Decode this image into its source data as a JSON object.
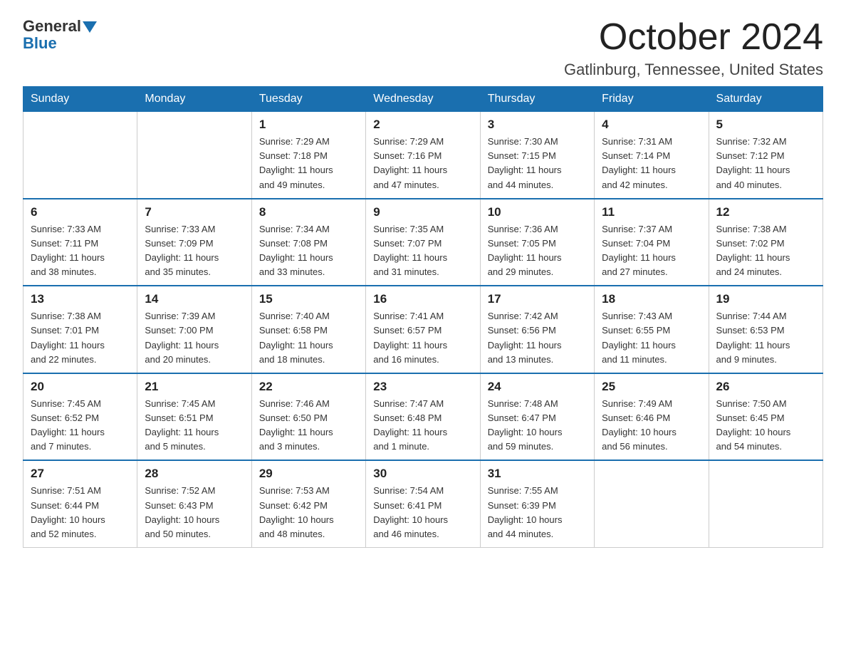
{
  "logo": {
    "general": "General",
    "blue": "Blue"
  },
  "title": "October 2024",
  "location": "Gatlinburg, Tennessee, United States",
  "weekdays": [
    "Sunday",
    "Monday",
    "Tuesday",
    "Wednesday",
    "Thursday",
    "Friday",
    "Saturday"
  ],
  "weeks": [
    [
      {
        "day": "",
        "info": ""
      },
      {
        "day": "",
        "info": ""
      },
      {
        "day": "1",
        "info": "Sunrise: 7:29 AM\nSunset: 7:18 PM\nDaylight: 11 hours\nand 49 minutes."
      },
      {
        "day": "2",
        "info": "Sunrise: 7:29 AM\nSunset: 7:16 PM\nDaylight: 11 hours\nand 47 minutes."
      },
      {
        "day": "3",
        "info": "Sunrise: 7:30 AM\nSunset: 7:15 PM\nDaylight: 11 hours\nand 44 minutes."
      },
      {
        "day": "4",
        "info": "Sunrise: 7:31 AM\nSunset: 7:14 PM\nDaylight: 11 hours\nand 42 minutes."
      },
      {
        "day": "5",
        "info": "Sunrise: 7:32 AM\nSunset: 7:12 PM\nDaylight: 11 hours\nand 40 minutes."
      }
    ],
    [
      {
        "day": "6",
        "info": "Sunrise: 7:33 AM\nSunset: 7:11 PM\nDaylight: 11 hours\nand 38 minutes."
      },
      {
        "day": "7",
        "info": "Sunrise: 7:33 AM\nSunset: 7:09 PM\nDaylight: 11 hours\nand 35 minutes."
      },
      {
        "day": "8",
        "info": "Sunrise: 7:34 AM\nSunset: 7:08 PM\nDaylight: 11 hours\nand 33 minutes."
      },
      {
        "day": "9",
        "info": "Sunrise: 7:35 AM\nSunset: 7:07 PM\nDaylight: 11 hours\nand 31 minutes."
      },
      {
        "day": "10",
        "info": "Sunrise: 7:36 AM\nSunset: 7:05 PM\nDaylight: 11 hours\nand 29 minutes."
      },
      {
        "day": "11",
        "info": "Sunrise: 7:37 AM\nSunset: 7:04 PM\nDaylight: 11 hours\nand 27 minutes."
      },
      {
        "day": "12",
        "info": "Sunrise: 7:38 AM\nSunset: 7:02 PM\nDaylight: 11 hours\nand 24 minutes."
      }
    ],
    [
      {
        "day": "13",
        "info": "Sunrise: 7:38 AM\nSunset: 7:01 PM\nDaylight: 11 hours\nand 22 minutes."
      },
      {
        "day": "14",
        "info": "Sunrise: 7:39 AM\nSunset: 7:00 PM\nDaylight: 11 hours\nand 20 minutes."
      },
      {
        "day": "15",
        "info": "Sunrise: 7:40 AM\nSunset: 6:58 PM\nDaylight: 11 hours\nand 18 minutes."
      },
      {
        "day": "16",
        "info": "Sunrise: 7:41 AM\nSunset: 6:57 PM\nDaylight: 11 hours\nand 16 minutes."
      },
      {
        "day": "17",
        "info": "Sunrise: 7:42 AM\nSunset: 6:56 PM\nDaylight: 11 hours\nand 13 minutes."
      },
      {
        "day": "18",
        "info": "Sunrise: 7:43 AM\nSunset: 6:55 PM\nDaylight: 11 hours\nand 11 minutes."
      },
      {
        "day": "19",
        "info": "Sunrise: 7:44 AM\nSunset: 6:53 PM\nDaylight: 11 hours\nand 9 minutes."
      }
    ],
    [
      {
        "day": "20",
        "info": "Sunrise: 7:45 AM\nSunset: 6:52 PM\nDaylight: 11 hours\nand 7 minutes."
      },
      {
        "day": "21",
        "info": "Sunrise: 7:45 AM\nSunset: 6:51 PM\nDaylight: 11 hours\nand 5 minutes."
      },
      {
        "day": "22",
        "info": "Sunrise: 7:46 AM\nSunset: 6:50 PM\nDaylight: 11 hours\nand 3 minutes."
      },
      {
        "day": "23",
        "info": "Sunrise: 7:47 AM\nSunset: 6:48 PM\nDaylight: 11 hours\nand 1 minute."
      },
      {
        "day": "24",
        "info": "Sunrise: 7:48 AM\nSunset: 6:47 PM\nDaylight: 10 hours\nand 59 minutes."
      },
      {
        "day": "25",
        "info": "Sunrise: 7:49 AM\nSunset: 6:46 PM\nDaylight: 10 hours\nand 56 minutes."
      },
      {
        "day": "26",
        "info": "Sunrise: 7:50 AM\nSunset: 6:45 PM\nDaylight: 10 hours\nand 54 minutes."
      }
    ],
    [
      {
        "day": "27",
        "info": "Sunrise: 7:51 AM\nSunset: 6:44 PM\nDaylight: 10 hours\nand 52 minutes."
      },
      {
        "day": "28",
        "info": "Sunrise: 7:52 AM\nSunset: 6:43 PM\nDaylight: 10 hours\nand 50 minutes."
      },
      {
        "day": "29",
        "info": "Sunrise: 7:53 AM\nSunset: 6:42 PM\nDaylight: 10 hours\nand 48 minutes."
      },
      {
        "day": "30",
        "info": "Sunrise: 7:54 AM\nSunset: 6:41 PM\nDaylight: 10 hours\nand 46 minutes."
      },
      {
        "day": "31",
        "info": "Sunrise: 7:55 AM\nSunset: 6:39 PM\nDaylight: 10 hours\nand 44 minutes."
      },
      {
        "day": "",
        "info": ""
      },
      {
        "day": "",
        "info": ""
      }
    ]
  ]
}
